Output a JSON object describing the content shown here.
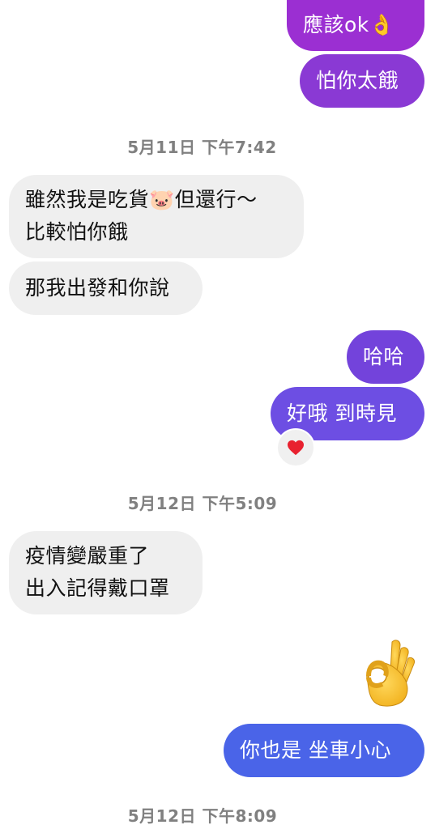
{
  "colors": {
    "bubble_purple_top": "#9b2fd2",
    "bubble_purple_mid": "#7842d8",
    "bubble_indigo": "#6d4ee3",
    "bubble_blue": "#4a64e8",
    "incoming_bg": "#efefef",
    "timestamp": "#808080",
    "reaction_heart": "#e8212f"
  },
  "messages": {
    "m1": "應該ok👌",
    "m2": "怕你太餓",
    "ts1": "5月11日 下午7:42",
    "m3_line1": "雖然我是吃貨🐷但還行～",
    "m3_line2": "比較怕你餓",
    "m4": "那我出發和你說",
    "m5": "哈哈",
    "m6": "好哦 到時見",
    "m6_reaction": "❤️",
    "ts2": "5月12日 下午5:09",
    "m7_line1": "疫情變嚴重了",
    "m7_line2": "出入記得戴口罩",
    "m8_emoji": "ok-hand-icon",
    "m9": "你也是 坐車小心",
    "ts3": "5月12日 下午8:09"
  }
}
